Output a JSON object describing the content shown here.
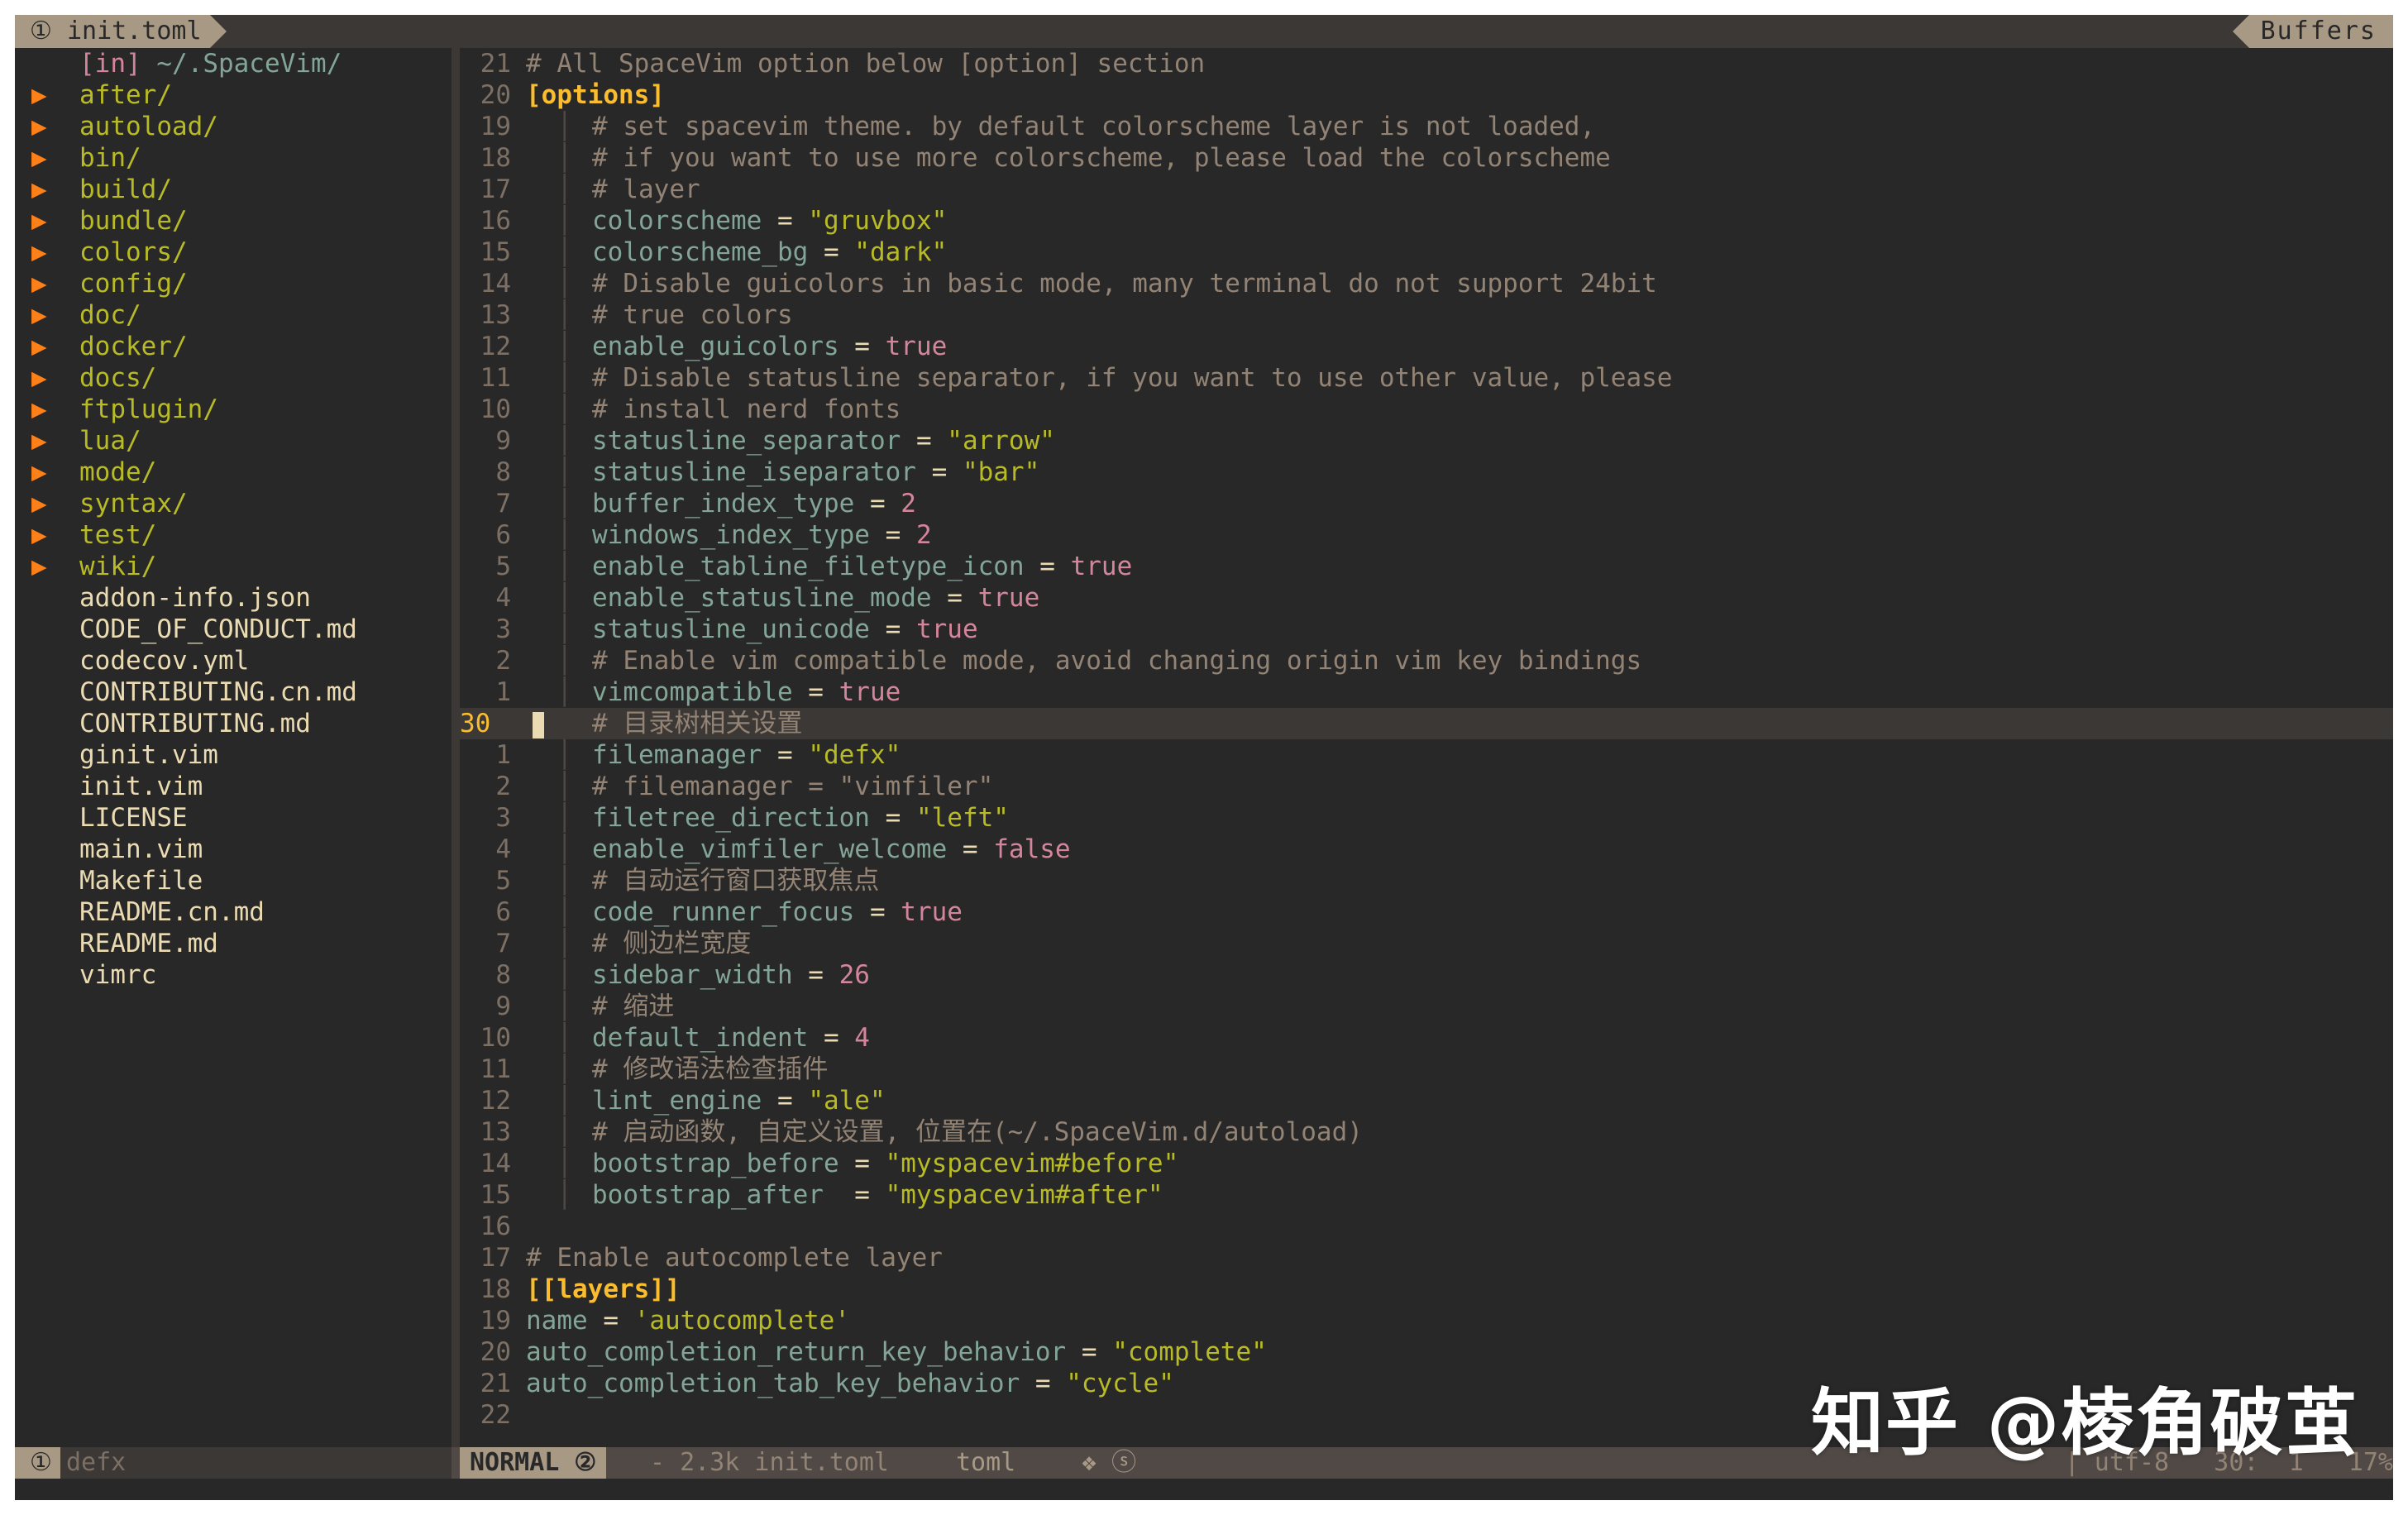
{
  "tabline": {
    "active_tab": "① init.toml",
    "buffers_label": "Buffers"
  },
  "tree": {
    "header_prefix": "[in]",
    "header_path": "~/.SpaceVim/",
    "items": [
      {
        "name": "after/",
        "type": "dir"
      },
      {
        "name": "autoload/",
        "type": "dir"
      },
      {
        "name": "bin/",
        "type": "dir"
      },
      {
        "name": "build/",
        "type": "dir"
      },
      {
        "name": "bundle/",
        "type": "dir"
      },
      {
        "name": "colors/",
        "type": "dir"
      },
      {
        "name": "config/",
        "type": "dir"
      },
      {
        "name": "doc/",
        "type": "dir"
      },
      {
        "name": "docker/",
        "type": "dir"
      },
      {
        "name": "docs/",
        "type": "dir"
      },
      {
        "name": "ftplugin/",
        "type": "dir"
      },
      {
        "name": "lua/",
        "type": "dir"
      },
      {
        "name": "mode/",
        "type": "dir"
      },
      {
        "name": "syntax/",
        "type": "dir"
      },
      {
        "name": "test/",
        "type": "dir"
      },
      {
        "name": "wiki/",
        "type": "dir"
      },
      {
        "name": "addon-info.json",
        "type": "file"
      },
      {
        "name": "CODE_OF_CONDUCT.md",
        "type": "file"
      },
      {
        "name": "codecov.yml",
        "type": "file"
      },
      {
        "name": "CONTRIBUTING.cn.md",
        "type": "file"
      },
      {
        "name": "CONTRIBUTING.md",
        "type": "file"
      },
      {
        "name": "ginit.vim",
        "type": "file"
      },
      {
        "name": "init.vim",
        "type": "file"
      },
      {
        "name": "LICENSE",
        "type": "file"
      },
      {
        "name": "main.vim",
        "type": "file"
      },
      {
        "name": "Makefile",
        "type": "file"
      },
      {
        "name": "README.cn.md",
        "type": "file"
      },
      {
        "name": "README.md",
        "type": "file"
      },
      {
        "name": "vimrc",
        "type": "file"
      }
    ]
  },
  "editor": {
    "lines": [
      {
        "n": "21",
        "indent": false,
        "tokens": [
          {
            "t": "# All SpaceVim option below [option] section",
            "c": "comment"
          }
        ]
      },
      {
        "n": "20",
        "indent": false,
        "tokens": [
          {
            "t": "[options]",
            "c": "header"
          }
        ]
      },
      {
        "n": "19",
        "indent": true,
        "tokens": [
          {
            "t": "# set spacevim theme. by default colorscheme layer is not loaded,",
            "c": "comment"
          }
        ]
      },
      {
        "n": "18",
        "indent": true,
        "tokens": [
          {
            "t": "# if you want to use more colorscheme, please load the colorscheme",
            "c": "comment"
          }
        ]
      },
      {
        "n": "17",
        "indent": true,
        "tokens": [
          {
            "t": "# layer",
            "c": "comment"
          }
        ]
      },
      {
        "n": "16",
        "indent": true,
        "tokens": [
          {
            "t": "colorscheme",
            "c": "key"
          },
          {
            "t": " = ",
            "c": "op"
          },
          {
            "t": "\"gruvbox\"",
            "c": "str"
          }
        ]
      },
      {
        "n": "15",
        "indent": true,
        "tokens": [
          {
            "t": "colorscheme_bg",
            "c": "key"
          },
          {
            "t": " = ",
            "c": "op"
          },
          {
            "t": "\"dark\"",
            "c": "str"
          }
        ]
      },
      {
        "n": "14",
        "indent": true,
        "tokens": [
          {
            "t": "# Disable guicolors in basic mode, many terminal do not support 24bit",
            "c": "comment"
          }
        ]
      },
      {
        "n": "13",
        "indent": true,
        "tokens": [
          {
            "t": "# true colors",
            "c": "comment"
          }
        ]
      },
      {
        "n": "12",
        "indent": true,
        "tokens": [
          {
            "t": "enable_guicolors",
            "c": "key"
          },
          {
            "t": " = ",
            "c": "op"
          },
          {
            "t": "true",
            "c": "bool"
          }
        ]
      },
      {
        "n": "11",
        "indent": true,
        "tokens": [
          {
            "t": "# Disable statusline separator, if you want to use other value, please",
            "c": "comment"
          }
        ]
      },
      {
        "n": "10",
        "indent": true,
        "tokens": [
          {
            "t": "# install nerd fonts",
            "c": "comment"
          }
        ]
      },
      {
        "n": "9",
        "indent": true,
        "tokens": [
          {
            "t": "statusline_separator",
            "c": "key"
          },
          {
            "t": " = ",
            "c": "op"
          },
          {
            "t": "\"arrow\"",
            "c": "str"
          }
        ]
      },
      {
        "n": "8",
        "indent": true,
        "tokens": [
          {
            "t": "statusline_iseparator",
            "c": "key"
          },
          {
            "t": " = ",
            "c": "op"
          },
          {
            "t": "\"bar\"",
            "c": "str"
          }
        ]
      },
      {
        "n": "7",
        "indent": true,
        "tokens": [
          {
            "t": "buffer_index_type",
            "c": "key"
          },
          {
            "t": " = ",
            "c": "op"
          },
          {
            "t": "2",
            "c": "num"
          }
        ]
      },
      {
        "n": "6",
        "indent": true,
        "tokens": [
          {
            "t": "windows_index_type",
            "c": "key"
          },
          {
            "t": " = ",
            "c": "op"
          },
          {
            "t": "2",
            "c": "num"
          }
        ]
      },
      {
        "n": "5",
        "indent": true,
        "tokens": [
          {
            "t": "enable_tabline_filetype_icon",
            "c": "key"
          },
          {
            "t": " = ",
            "c": "op"
          },
          {
            "t": "true",
            "c": "bool"
          }
        ]
      },
      {
        "n": "4",
        "indent": true,
        "tokens": [
          {
            "t": "enable_statusline_mode",
            "c": "key"
          },
          {
            "t": " = ",
            "c": "op"
          },
          {
            "t": "true",
            "c": "bool"
          }
        ]
      },
      {
        "n": "3",
        "indent": true,
        "tokens": [
          {
            "t": "statusline_unicode",
            "c": "key"
          },
          {
            "t": " = ",
            "c": "op"
          },
          {
            "t": "true",
            "c": "bool"
          }
        ]
      },
      {
        "n": "2",
        "indent": true,
        "tokens": [
          {
            "t": "# Enable vim compatible mode, avoid changing origin vim key bindings",
            "c": "comment"
          }
        ]
      },
      {
        "n": "1",
        "indent": true,
        "tokens": [
          {
            "t": "vimcompatible",
            "c": "key"
          },
          {
            "t": " = ",
            "c": "op"
          },
          {
            "t": "true",
            "c": "bool"
          }
        ]
      },
      {
        "n": "30",
        "indent": true,
        "current": true,
        "tokens": [
          {
            "t": "# 目录树相关设置",
            "c": "comment"
          }
        ]
      },
      {
        "n": "1",
        "indent": true,
        "tokens": [
          {
            "t": "filemanager",
            "c": "key"
          },
          {
            "t": " = ",
            "c": "op"
          },
          {
            "t": "\"defx\"",
            "c": "str"
          }
        ]
      },
      {
        "n": "2",
        "indent": true,
        "tokens": [
          {
            "t": "# filemanager = \"vimfiler\"",
            "c": "comment"
          }
        ]
      },
      {
        "n": "3",
        "indent": true,
        "tokens": [
          {
            "t": "filetree_direction",
            "c": "key"
          },
          {
            "t": " = ",
            "c": "op"
          },
          {
            "t": "\"left\"",
            "c": "str"
          }
        ]
      },
      {
        "n": "4",
        "indent": true,
        "tokens": [
          {
            "t": "enable_vimfiler_welcome",
            "c": "key"
          },
          {
            "t": " = ",
            "c": "op"
          },
          {
            "t": "false",
            "c": "bool"
          }
        ]
      },
      {
        "n": "5",
        "indent": true,
        "tokens": [
          {
            "t": "# 自动运行窗口获取焦点",
            "c": "comment"
          }
        ]
      },
      {
        "n": "6",
        "indent": true,
        "tokens": [
          {
            "t": "code_runner_focus",
            "c": "key"
          },
          {
            "t": " = ",
            "c": "op"
          },
          {
            "t": "true",
            "c": "bool"
          }
        ]
      },
      {
        "n": "7",
        "indent": true,
        "tokens": [
          {
            "t": "# 侧边栏宽度",
            "c": "comment"
          }
        ]
      },
      {
        "n": "8",
        "indent": true,
        "tokens": [
          {
            "t": "sidebar_width",
            "c": "key"
          },
          {
            "t": " = ",
            "c": "op"
          },
          {
            "t": "26",
            "c": "num"
          }
        ]
      },
      {
        "n": "9",
        "indent": true,
        "tokens": [
          {
            "t": "# 缩进",
            "c": "comment"
          }
        ]
      },
      {
        "n": "10",
        "indent": true,
        "tokens": [
          {
            "t": "default_indent",
            "c": "key"
          },
          {
            "t": " = ",
            "c": "op"
          },
          {
            "t": "4",
            "c": "num"
          }
        ]
      },
      {
        "n": "11",
        "indent": true,
        "tokens": [
          {
            "t": "# 修改语法检查插件",
            "c": "comment"
          }
        ]
      },
      {
        "n": "12",
        "indent": true,
        "tokens": [
          {
            "t": "lint_engine",
            "c": "key"
          },
          {
            "t": " = ",
            "c": "op"
          },
          {
            "t": "\"ale\"",
            "c": "str"
          }
        ]
      },
      {
        "n": "13",
        "indent": true,
        "tokens": [
          {
            "t": "# 启动函数, 自定义设置, 位置在(~/.SpaceVim.d/autoload)",
            "c": "comment"
          }
        ]
      },
      {
        "n": "14",
        "indent": true,
        "tokens": [
          {
            "t": "bootstrap_before",
            "c": "key"
          },
          {
            "t": " = ",
            "c": "op"
          },
          {
            "t": "\"myspacevim#before\"",
            "c": "str"
          }
        ]
      },
      {
        "n": "15",
        "indent": true,
        "tokens": [
          {
            "t": "bootstrap_after",
            "c": "key"
          },
          {
            "t": "  = ",
            "c": "op"
          },
          {
            "t": "\"myspacevim#after\"",
            "c": "str"
          }
        ]
      },
      {
        "n": "16",
        "indent": false,
        "tokens": []
      },
      {
        "n": "17",
        "indent": false,
        "tokens": [
          {
            "t": "# Enable autocomplete layer",
            "c": "comment"
          }
        ]
      },
      {
        "n": "18",
        "indent": false,
        "tokens": [
          {
            "t": "[[layers]]",
            "c": "header"
          }
        ]
      },
      {
        "n": "19",
        "indent": false,
        "tokens": [
          {
            "t": "name",
            "c": "key"
          },
          {
            "t": " = ",
            "c": "op"
          },
          {
            "t": "'autocomplete'",
            "c": "str"
          }
        ]
      },
      {
        "n": "20",
        "indent": false,
        "tokens": [
          {
            "t": "auto_completion_return_key_behavior",
            "c": "key"
          },
          {
            "t": " = ",
            "c": "op"
          },
          {
            "t": "\"complete\"",
            "c": "str"
          }
        ]
      },
      {
        "n": "21",
        "indent": false,
        "tokens": [
          {
            "t": "auto_completion_tab_key_behavior",
            "c": "key"
          },
          {
            "t": " = ",
            "c": "op"
          },
          {
            "t": "\"cycle\"",
            "c": "str"
          }
        ]
      },
      {
        "n": "22",
        "indent": false,
        "tokens": []
      }
    ]
  },
  "statusline": {
    "left_winnum": "①",
    "left_filename": "defx",
    "mode": "NORMAL ②",
    "info": "- 2.3k init.toml",
    "filetype": "toml",
    "extra": "❖ ⓢ",
    "right": " | utf-8   30:  1   17%"
  },
  "watermark": "知乎 @棱角破茧",
  "colors": {
    "background": "#282828",
    "foreground": "#ebdbb2",
    "comment": "#928374",
    "string": "#b8bb26",
    "keyword": "#83a598",
    "boolean": "#d3869b",
    "header": "#fabd2f",
    "arrow": "#fe8019"
  }
}
